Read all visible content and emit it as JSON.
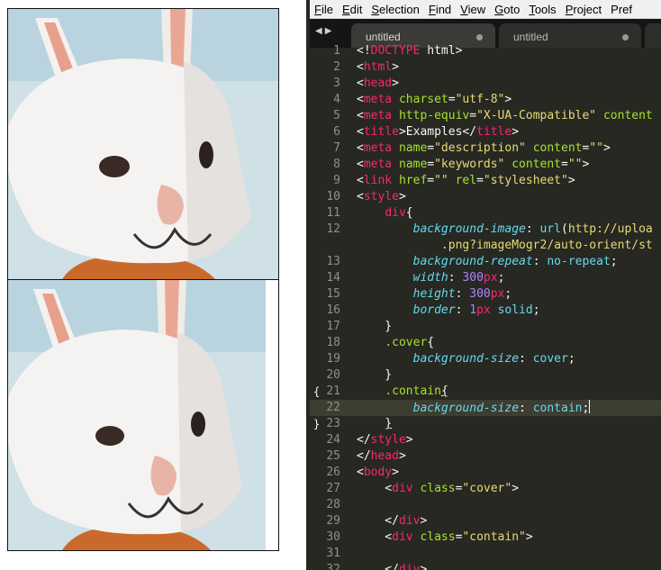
{
  "menubar": {
    "items": [
      {
        "key": "F",
        "rest": "ile"
      },
      {
        "key": "E",
        "rest": "dit"
      },
      {
        "key": "S",
        "rest": "election"
      },
      {
        "key": "F",
        "rest": "ind"
      },
      {
        "key": "V",
        "rest": "iew"
      },
      {
        "key": "G",
        "rest": "oto"
      },
      {
        "key": "T",
        "rest": "ools"
      },
      {
        "key": "P",
        "rest": "roject"
      },
      {
        "key": "",
        "rest": "Pref"
      }
    ]
  },
  "tabs": [
    {
      "label": "untitled"
    },
    {
      "label": "untitled"
    }
  ],
  "editor": {
    "current_line": 22,
    "line_numbers": [
      "1",
      "2",
      "3",
      "4",
      "5",
      "6",
      "7",
      "8",
      "9",
      "10",
      "11",
      "12",
      "",
      "13",
      "14",
      "15",
      "16",
      "17",
      "18",
      "19",
      "20",
      "21",
      "22",
      "23",
      "24",
      "25",
      "26",
      "27",
      "28",
      "29",
      "30",
      "31",
      "32"
    ],
    "folds": {
      "21": "{",
      "23": "}"
    },
    "lines": [
      [
        [
          "pl",
          "<!"
        ],
        [
          "tg",
          "DOCTYPE"
        ],
        [
          "pl",
          " html>"
        ]
      ],
      [
        [
          "pl",
          "<"
        ],
        [
          "tg",
          "html"
        ],
        [
          "pl",
          ">"
        ]
      ],
      [
        [
          "pl",
          "<"
        ],
        [
          "tg",
          "head"
        ],
        [
          "pl",
          ">"
        ]
      ],
      [
        [
          "pl",
          "<"
        ],
        [
          "tg",
          "meta"
        ],
        [
          "pl",
          " "
        ],
        [
          "at",
          "charset"
        ],
        [
          "pl",
          "="
        ],
        [
          "st",
          "\"utf-8\""
        ],
        [
          "pl",
          ">"
        ]
      ],
      [
        [
          "pl",
          "<"
        ],
        [
          "tg",
          "meta"
        ],
        [
          "pl",
          " "
        ],
        [
          "at",
          "http-equiv"
        ],
        [
          "pl",
          "="
        ],
        [
          "st",
          "\"X-UA-Compatible\""
        ],
        [
          "pl",
          " "
        ],
        [
          "at",
          "content"
        ]
      ],
      [
        [
          "pl",
          "<"
        ],
        [
          "tg",
          "title"
        ],
        [
          "pl",
          ">Examples</"
        ],
        [
          "tg",
          "title"
        ],
        [
          "pl",
          ">"
        ]
      ],
      [
        [
          "pl",
          "<"
        ],
        [
          "tg",
          "meta"
        ],
        [
          "pl",
          " "
        ],
        [
          "at",
          "name"
        ],
        [
          "pl",
          "="
        ],
        [
          "st",
          "\"description\""
        ],
        [
          "pl",
          " "
        ],
        [
          "at",
          "content"
        ],
        [
          "pl",
          "="
        ],
        [
          "st",
          "\"\""
        ],
        [
          "pl",
          ">"
        ]
      ],
      [
        [
          "pl",
          "<"
        ],
        [
          "tg",
          "meta"
        ],
        [
          "pl",
          " "
        ],
        [
          "at",
          "name"
        ],
        [
          "pl",
          "="
        ],
        [
          "st",
          "\"keywords\""
        ],
        [
          "pl",
          " "
        ],
        [
          "at",
          "content"
        ],
        [
          "pl",
          "="
        ],
        [
          "st",
          "\"\""
        ],
        [
          "pl",
          ">"
        ]
      ],
      [
        [
          "pl",
          "<"
        ],
        [
          "tg",
          "link"
        ],
        [
          "pl",
          " "
        ],
        [
          "at",
          "href"
        ],
        [
          "pl",
          "="
        ],
        [
          "st",
          "\"\""
        ],
        [
          "pl",
          " "
        ],
        [
          "at",
          "rel"
        ],
        [
          "pl",
          "="
        ],
        [
          "st",
          "\"stylesheet\""
        ],
        [
          "pl",
          ">"
        ]
      ],
      [
        [
          "pl",
          "<"
        ],
        [
          "tg",
          "style"
        ],
        [
          "pl",
          ">"
        ]
      ],
      [
        [
          "pl",
          "    "
        ],
        [
          "tg",
          "div"
        ],
        [
          "pl",
          "{"
        ]
      ],
      [
        [
          "pl",
          "        "
        ],
        [
          "pr",
          "background-image"
        ],
        [
          "pl",
          ": "
        ],
        [
          "vl",
          "url"
        ],
        [
          "pl",
          "("
        ],
        [
          "st",
          "http://uploa"
        ]
      ],
      [
        [
          "pl",
          "            "
        ],
        [
          "st",
          ".png?imageMogr2/auto-orient/st"
        ]
      ],
      [
        [
          "pl",
          "        "
        ],
        [
          "pr",
          "background-repeat"
        ],
        [
          "pl",
          ": "
        ],
        [
          "vl",
          "no-repeat"
        ],
        [
          "pl",
          ";"
        ]
      ],
      [
        [
          "pl",
          "        "
        ],
        [
          "pr",
          "width"
        ],
        [
          "pl",
          ": "
        ],
        [
          "nm",
          "300"
        ],
        [
          "tg",
          "px"
        ],
        [
          "pl",
          ";"
        ]
      ],
      [
        [
          "pl",
          "        "
        ],
        [
          "pr",
          "height"
        ],
        [
          "pl",
          ": "
        ],
        [
          "nm",
          "300"
        ],
        [
          "tg",
          "px"
        ],
        [
          "pl",
          ";"
        ]
      ],
      [
        [
          "pl",
          "        "
        ],
        [
          "pr",
          "border"
        ],
        [
          "pl",
          ": "
        ],
        [
          "nm",
          "1"
        ],
        [
          "tg",
          "px"
        ],
        [
          "pl",
          " "
        ],
        [
          "vl",
          "solid"
        ],
        [
          "pl",
          ";"
        ]
      ],
      [
        [
          "pl",
          "    }"
        ]
      ],
      [
        [
          "pl",
          "    "
        ],
        [
          "cl",
          ".cover"
        ],
        [
          "pl",
          "{"
        ]
      ],
      [
        [
          "pl",
          "        "
        ],
        [
          "pr",
          "background-size"
        ],
        [
          "pl",
          ": "
        ],
        [
          "vl",
          "cover"
        ],
        [
          "pl",
          ";"
        ]
      ],
      [
        [
          "pl",
          "    }"
        ]
      ],
      [
        [
          "pl",
          "    "
        ],
        [
          "cl",
          ".contain"
        ],
        [
          "ul",
          "{"
        ]
      ],
      [
        [
          "pl",
          "        "
        ],
        [
          "pr",
          "background-size"
        ],
        [
          "pl",
          ": "
        ],
        [
          "vl",
          "contain"
        ],
        [
          "pl",
          ";"
        ],
        [
          "cur",
          ""
        ]
      ],
      [
        [
          "pl",
          "    "
        ],
        [
          "ul",
          "}"
        ]
      ],
      [
        [
          "pl",
          "</"
        ],
        [
          "tg",
          "style"
        ],
        [
          "pl",
          ">"
        ]
      ],
      [
        [
          "pl",
          "</"
        ],
        [
          "tg",
          "head"
        ],
        [
          "pl",
          ">"
        ]
      ],
      [
        [
          "pl",
          "<"
        ],
        [
          "tg",
          "body"
        ],
        [
          "pl",
          ">"
        ]
      ],
      [
        [
          "pl",
          "    <"
        ],
        [
          "tg",
          "div"
        ],
        [
          "pl",
          " "
        ],
        [
          "at",
          "class"
        ],
        [
          "pl",
          "="
        ],
        [
          "st",
          "\"cover\""
        ],
        [
          "pl",
          ">"
        ]
      ],
      [],
      [
        [
          "pl",
          "    </"
        ],
        [
          "tg",
          "div"
        ],
        [
          "pl",
          ">"
        ]
      ],
      [
        [
          "pl",
          "    <"
        ],
        [
          "tg",
          "div"
        ],
        [
          "pl",
          " "
        ],
        [
          "at",
          "class"
        ],
        [
          "pl",
          "="
        ],
        [
          "st",
          "\"contain\""
        ],
        [
          "pl",
          ">"
        ]
      ],
      [],
      [
        [
          "pl",
          "    </"
        ],
        [
          "tg",
          "div"
        ],
        [
          "pl",
          ">"
        ]
      ]
    ]
  },
  "colors": {
    "editor_bg": "#272822",
    "tag": "#f92672",
    "attribute": "#a6e22e",
    "string": "#e6db74",
    "property": "#66d9ef",
    "number": "#ae81ff"
  }
}
